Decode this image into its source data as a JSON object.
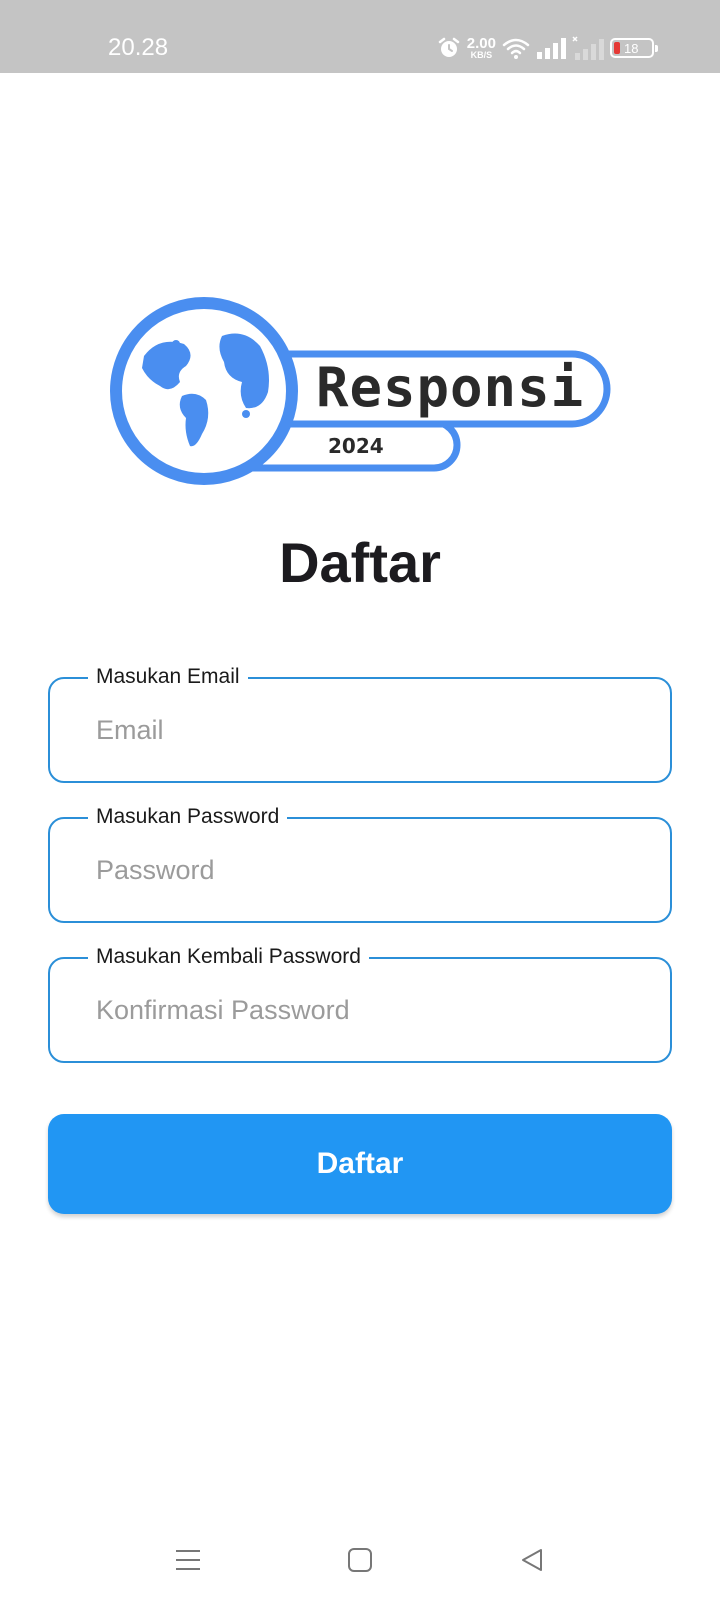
{
  "status_bar": {
    "time": "20.28",
    "net_speed_value": "2.00",
    "net_speed_unit": "KB/S",
    "battery_level": "18",
    "icons": [
      "alarm-icon",
      "wifi-icon",
      "signal-icon",
      "signal-off-icon",
      "battery-icon"
    ]
  },
  "logo": {
    "name": "Responsi",
    "year": "2024",
    "color": "#4a8ef0"
  },
  "page": {
    "title": "Daftar"
  },
  "form": {
    "email": {
      "label": "Masukan Email",
      "placeholder": "Email",
      "value": ""
    },
    "password": {
      "label": "Masukan Password",
      "placeholder": "Password",
      "value": ""
    },
    "confirm_password": {
      "label": "Masukan Kembali Password",
      "placeholder": "Konfirmasi Password",
      "value": ""
    },
    "submit_label": "Daftar"
  },
  "colors": {
    "accent": "#2196f3",
    "field_border": "#2b8fd8",
    "status_bar_bg": "#c4c4c4"
  },
  "nav": {
    "icons": [
      "menu-icon",
      "home-icon",
      "back-icon"
    ]
  }
}
